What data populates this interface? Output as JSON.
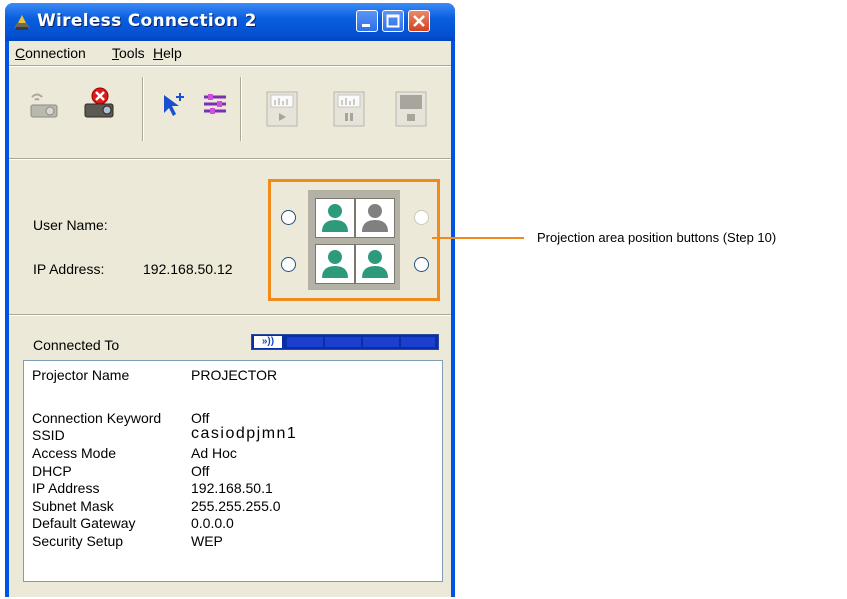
{
  "window": {
    "title": "Wireless Connection 2"
  },
  "menu": [
    {
      "accel": "C",
      "rest": "onnection"
    },
    {
      "accel": "T",
      "rest": "ools"
    },
    {
      "accel": "H",
      "rest": "elp"
    }
  ],
  "toolbar": {
    "buttons": [
      "connect-projector-icon",
      "disconnect-projector-icon",
      "select-projector-icon",
      "settings-icon",
      "play-icon",
      "pause-icon",
      "stop-icon"
    ]
  },
  "user": {
    "name_label": "User Name:",
    "name_value": "",
    "ip_label": "IP Address:",
    "ip_value": "192.168.50.12"
  },
  "connection": {
    "label": "Connected To",
    "signal_icon_text": "»))"
  },
  "info": {
    "rows": [
      {
        "label": "Projector Name",
        "value": "PROJECTOR"
      },
      {
        "label": "Connection Keyword",
        "value": "Off"
      },
      {
        "label": "SSID",
        "value": "casiodpjmn1"
      },
      {
        "label": "Access Mode",
        "value": "Ad Hoc"
      },
      {
        "label": "DHCP",
        "value": "Off"
      },
      {
        "label": "IP Address",
        "value": "192.168.50.1"
      },
      {
        "label": "Subnet Mask",
        "value": "255.255.255.0"
      },
      {
        "label": "Default Gateway",
        "value": "0.0.0.0"
      },
      {
        "label": "Security Setup",
        "value": "WEP"
      }
    ]
  },
  "annotation": {
    "text": "Projection area position buttons (Step 10)"
  },
  "colors": {
    "highlight": "#f08a1a",
    "titlebar": "#0054e3",
    "user_active": "#2e9a7c",
    "user_inactive": "#808080"
  }
}
